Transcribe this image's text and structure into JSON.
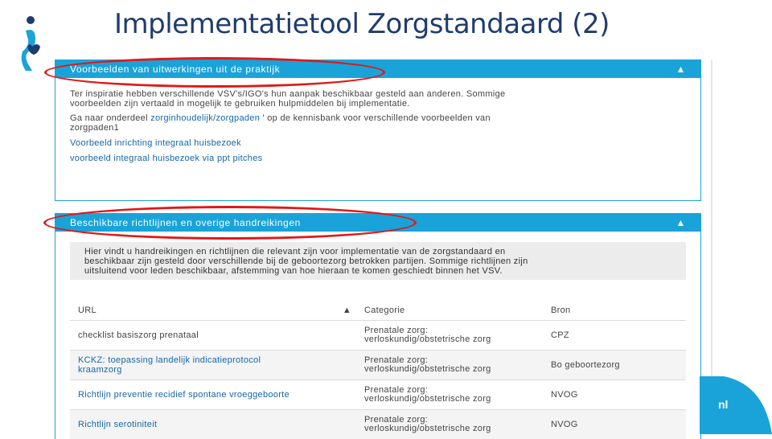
{
  "slide": {
    "title": "Implementatietool Zorgstandaard (2)"
  },
  "panel1": {
    "header": "Voorbeelden van uitwerkingen uit de praktijk",
    "intro_line1": "Ter inspiratie hebben verschillende VSV's/IGO's hun aanpak beschikbaar gesteld aan anderen. Sommige",
    "intro_line2": "voorbeelden zijn vertaald in mogelijk te gebruiken hulpmiddelen bij implementatie.",
    "goto_prefix": "Ga naar onderdeel ",
    "goto_link": "zorginhoudelijk/zorgpaden",
    "goto_suffix": " ' op de kennisbank voor verschillende voorbeelden van",
    "goto_line2": "zorgpaden1",
    "link1": "Voorbeeld inrichting integraal huisbezoek",
    "link2": "voorbeeld integraal huisbezoek via ppt pitches"
  },
  "panel2": {
    "header": "Beschikbare richtlijnen en overige handreikingen",
    "intro_line1": "Hier vindt u handreikingen en richtlijnen die relevant zijn voor implementatie van de zorgstandaard en",
    "intro_line2": "beschikbaar zijn gesteld door verschillende bij de geboortezorg betrokken partijen. Sommige richtlijnen zijn",
    "intro_line3": "uitsluitend voor leden beschikbaar, afstemming van hoe hieraan te komen geschiedt binnen het VSV.",
    "columns": {
      "url": "URL",
      "categorie": "Categorie",
      "bron": "Bron"
    },
    "rows": [
      {
        "url_line1": "checklist basiszorg prenataal",
        "url_line2": "",
        "cat_line1": "Prenatale zorg:",
        "cat_line2": "verloskundig/obstetrische zorg",
        "bron": "CPZ"
      },
      {
        "url_line1": "KCKZ: toepassing landelijk indicatieprotocol",
        "url_line2": "kraamzorg",
        "cat_line1": "Prenatale zorg:",
        "cat_line2": "verloskundig/obstetrische zorg",
        "bron": "Bo geboortezorg"
      },
      {
        "url_line1": "Richtlijn preventie recidief spontane vroeggeboorte",
        "url_line2": "",
        "cat_line1": "Prenatale zorg:",
        "cat_line2": "verloskundig/obstetrische zorg",
        "bron": "NVOG"
      },
      {
        "url_line1": "Richtlijn serotiniteit",
        "url_line2": "",
        "cat_line1": "Prenatale zorg:",
        "cat_line2": "verloskundig/obstetrische zorg",
        "bron": "NVOG"
      }
    ]
  },
  "corner": {
    "text": "nl"
  },
  "colors": {
    "accent": "#1aa3d9",
    "title": "#1f3c6e",
    "highlight": "#e01919",
    "link": "#1466a8"
  },
  "icons": {
    "collapse": "chevron-up-icon",
    "sort": "sort-ascending-icon",
    "logo": "mother-child-logo-icon"
  }
}
